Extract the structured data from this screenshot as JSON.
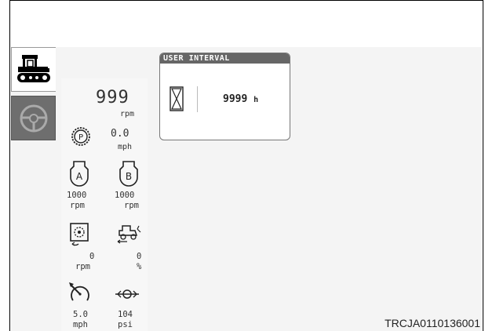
{
  "engine": {
    "speed": "999",
    "speed_unit": "rpm"
  },
  "pto": {
    "icon": "pto-icon",
    "speed": "0.0",
    "speed_unit": "mph"
  },
  "hitch_a": {
    "icon": "hitch-a-icon",
    "label": "A",
    "value": "1000",
    "unit": "rpm"
  },
  "hitch_b": {
    "icon": "hitch-b-icon",
    "label": "B",
    "value": "1000",
    "unit": "rpm"
  },
  "fan": {
    "icon": "fan-icon",
    "value": "0",
    "unit": "rpm"
  },
  "wheel_slip": {
    "icon": "wheel-slip-icon",
    "value": "0",
    "unit": "%"
  },
  "ground_speed": {
    "icon": "speedometer-icon",
    "value": "5.0",
    "unit": "mph"
  },
  "pressure": {
    "icon": "hydraulic-pressure-icon",
    "value": "104",
    "unit": "psi"
  },
  "user_interval": {
    "title": "USER INTERVAL",
    "icon": "hourglass-icon",
    "value": "9999",
    "unit": "h"
  },
  "tabs": [
    {
      "icon": "tractor-icon",
      "active": true
    },
    {
      "icon": "steering-wheel-icon",
      "active": false
    }
  ],
  "caption": "TRCJA0110136001"
}
